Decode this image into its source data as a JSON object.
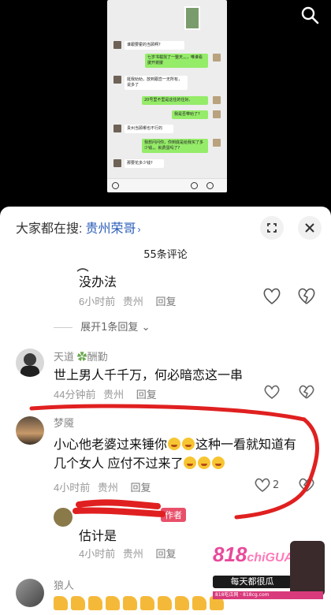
{
  "video": {
    "chat_messages": [
      {
        "side": "left",
        "text": "谁跟要霍的当顾啊?"
      },
      {
        "side": "right",
        "text": "七岁书载找了一整天，。，唯谁看援开谢援"
      },
      {
        "side": "left",
        "text": "挺我劝劝，放到跟恋一无所有，说多了"
      },
      {
        "side": "right",
        "text": "20号里不里是这住的住好。"
      },
      {
        "side": "right",
        "text": "我是否带劝了?"
      },
      {
        "side": "left",
        "text": "贵州当顾哪也不行的"
      },
      {
        "side": "right",
        "text": "我想问问你，你到底是给我买了多少钱，。就费蛋吗了?"
      },
      {
        "side": "left",
        "text": "那要花多少钱?"
      }
    ]
  },
  "sheet": {
    "hot_search_prefix": "大家都在搜:",
    "hot_search_link": "贵州荣哥",
    "comment_count": "55条评论",
    "expand_label": "展开1条回复",
    "comments": [
      {
        "text": "没办法",
        "time": "6小时前",
        "location": "贵州",
        "reply": "回复"
      },
      {
        "name": "天道",
        "badge": "酬勤",
        "text": "世上男人千千万，何必暗恋这一串",
        "time": "44分钟前",
        "location": "贵州",
        "reply": "回复"
      },
      {
        "name": "梦魇",
        "text_line1": "小心他老婆过来锤你",
        "text_line1b": "这种一看就知道有",
        "text_line2": "几个女人  应付不过来了",
        "time": "4小时前",
        "location": "贵州",
        "reply": "回复",
        "likes": "2"
      },
      {
        "author_tag": "作者",
        "text": "估计是",
        "time": "4小时前",
        "location": "贵州",
        "reply": "回复"
      },
      {
        "name": "狼人"
      }
    ]
  },
  "watermark": {
    "logo": "818",
    "logo_sub": "chiGUA",
    "slogan": "每天都很瓜",
    "strip": "818吃瓜网 · 818cg.com"
  },
  "colors": {
    "accent_link": "#2a5cb8",
    "author_tag": "#e8506a",
    "annotation_red": "#e02020",
    "wechat_green": "#95ec69"
  }
}
